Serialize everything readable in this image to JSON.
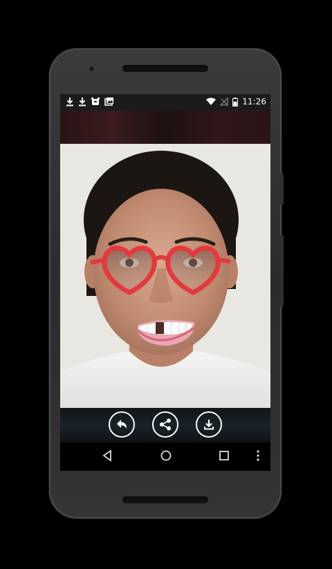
{
  "status_bar": {
    "time": "11:26",
    "left_icons": [
      "download-icon",
      "download-icon",
      "alarm-icon",
      "photo-icon"
    ],
    "right_icons": [
      "wifi-icon",
      "no-signal-icon",
      "battery-icon"
    ]
  },
  "actions": [
    {
      "name": "undo-button",
      "icon": "undo-arrow-icon"
    },
    {
      "name": "share-button",
      "icon": "share-icon"
    },
    {
      "name": "save-button",
      "icon": "download-icon"
    }
  ],
  "nav": [
    "back-icon",
    "home-icon",
    "recents-icon",
    "more-icon"
  ],
  "stickers": [
    "heart-glasses",
    "gap-teeth-mouth"
  ]
}
